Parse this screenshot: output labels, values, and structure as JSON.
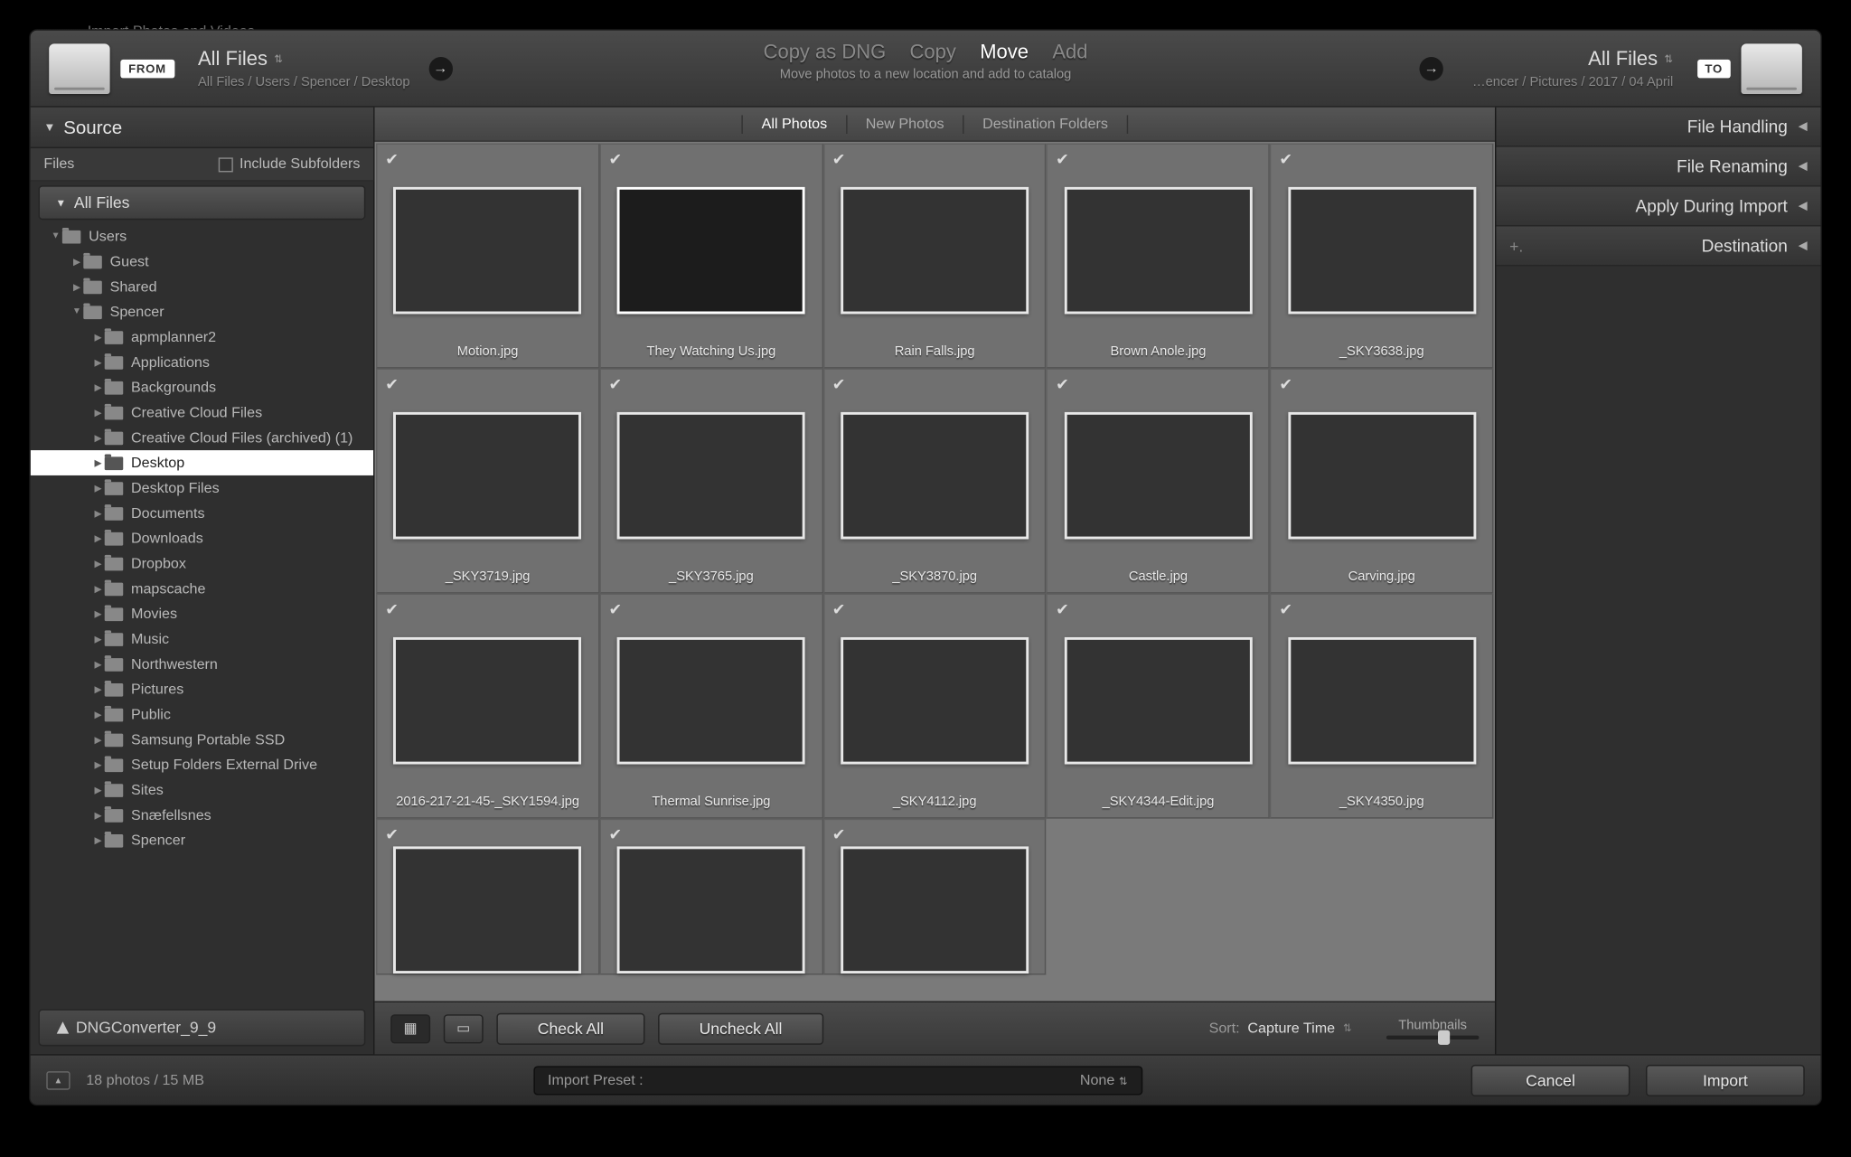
{
  "dialogTitle": "Import Photos and Videos",
  "source": {
    "chip": "FROM",
    "title": "All Files",
    "path": "All Files / Users / Spencer / Desktop"
  },
  "destination": {
    "chip": "TO",
    "title": "All Files",
    "path": "…encer / Pictures / 2017 / 04 April"
  },
  "modes": [
    "Copy as DNG",
    "Copy",
    "Move",
    "Add"
  ],
  "modeSelected": "Move",
  "modeSubtitle": "Move photos to a new location and add to catalog",
  "leftPanel": {
    "header": "Source",
    "filesLabel": "Files",
    "includeSubfolders": "Include Subfolders",
    "allFiles": "All Files",
    "dngConverter": "DNGConverter_9_9",
    "tree": [
      {
        "label": "Users",
        "depth": 0,
        "expanded": true
      },
      {
        "label": "Guest",
        "depth": 1,
        "expanded": false
      },
      {
        "label": "Shared",
        "depth": 1,
        "expanded": false
      },
      {
        "label": "Spencer",
        "depth": 1,
        "expanded": true
      },
      {
        "label": "apmplanner2",
        "depth": 2,
        "expanded": false
      },
      {
        "label": "Applications",
        "depth": 2,
        "expanded": false
      },
      {
        "label": "Backgrounds",
        "depth": 2,
        "expanded": false
      },
      {
        "label": "Creative Cloud Files",
        "depth": 2,
        "expanded": false
      },
      {
        "label": "Creative Cloud Files (archived) (1)",
        "depth": 2,
        "expanded": false
      },
      {
        "label": "Desktop",
        "depth": 2,
        "expanded": false,
        "selected": true
      },
      {
        "label": "Desktop Files",
        "depth": 2,
        "expanded": false
      },
      {
        "label": "Documents",
        "depth": 2,
        "expanded": false
      },
      {
        "label": "Downloads",
        "depth": 2,
        "expanded": false
      },
      {
        "label": "Dropbox",
        "depth": 2,
        "expanded": false
      },
      {
        "label": "mapscache",
        "depth": 2,
        "expanded": false
      },
      {
        "label": "Movies",
        "depth": 2,
        "expanded": false
      },
      {
        "label": "Music",
        "depth": 2,
        "expanded": false
      },
      {
        "label": "Northwestern",
        "depth": 2,
        "expanded": false
      },
      {
        "label": "Pictures",
        "depth": 2,
        "expanded": false
      },
      {
        "label": "Public",
        "depth": 2,
        "expanded": false
      },
      {
        "label": "Samsung Portable SSD",
        "depth": 2,
        "expanded": false
      },
      {
        "label": "Setup Folders External Drive",
        "depth": 2,
        "expanded": false
      },
      {
        "label": "Sites",
        "depth": 2,
        "expanded": false
      },
      {
        "label": "Snæfellsnes",
        "depth": 2,
        "expanded": false
      },
      {
        "label": "Spencer",
        "depth": 2,
        "expanded": false
      }
    ]
  },
  "viewTabs": [
    "All Photos",
    "New Photos",
    "Destination Folders"
  ],
  "thumbnails": [
    {
      "name": "Motion.jpg",
      "art": "t-bw1",
      "checked": true
    },
    {
      "name": "They Watching Us.jpg",
      "art": "t-wall",
      "checked": true
    },
    {
      "name": "Rain Falls.jpg",
      "art": "t-wfall",
      "checked": true
    },
    {
      "name": "Brown Anole.jpg",
      "art": "t-anole",
      "checked": true
    },
    {
      "name": "_SKY3638.jpg",
      "art": "t-ice1",
      "checked": true
    },
    {
      "name": "_SKY3719.jpg",
      "art": "t-ice2",
      "checked": true
    },
    {
      "name": "_SKY3765.jpg",
      "art": "t-ice3",
      "checked": true
    },
    {
      "name": "_SKY3870.jpg",
      "art": "t-ice4",
      "checked": true
    },
    {
      "name": "Castle.jpg",
      "art": "t-castle",
      "checked": true
    },
    {
      "name": "Carving.jpg",
      "art": "t-carve",
      "checked": true
    },
    {
      "name": "2016-217-21-45-_SKY1594.jpg",
      "art": "t-tree",
      "checked": true
    },
    {
      "name": "Thermal Sunrise.jpg",
      "art": "t-therm",
      "checked": true
    },
    {
      "name": "_SKY4112.jpg",
      "art": "t-valley",
      "checked": true
    },
    {
      "name": "_SKY4344-Edit.jpg",
      "art": "t-rock1",
      "checked": true
    },
    {
      "name": "_SKY4350.jpg",
      "art": "t-rock2",
      "checked": true
    },
    {
      "name": "",
      "art": "t-mtn1",
      "checked": true,
      "partial": true
    },
    {
      "name": "",
      "art": "t-mtn2",
      "checked": true,
      "partial": true
    },
    {
      "name": "",
      "art": "t-mtn3",
      "checked": true,
      "partial": true
    }
  ],
  "toolbar": {
    "checkAll": "Check All",
    "uncheckAll": "Uncheck All",
    "sortLabel": "Sort:",
    "sortValue": "Capture Time",
    "thumbLabel": "Thumbnails"
  },
  "rightPanels": [
    "File Handling",
    "File Renaming",
    "Apply During Import",
    "Destination"
  ],
  "footer": {
    "status": "18 photos / 15 MB",
    "presetLabel": "Import Preset :",
    "presetValue": "None",
    "cancel": "Cancel",
    "import": "Import"
  }
}
